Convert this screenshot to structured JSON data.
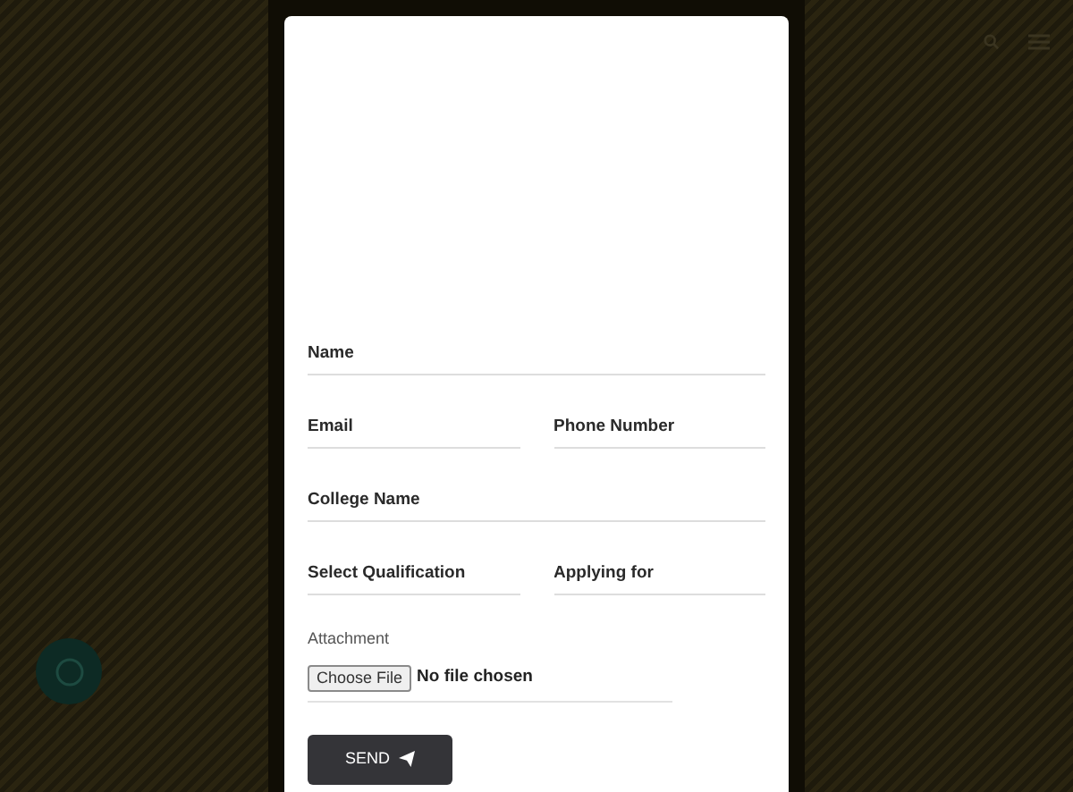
{
  "form": {
    "fields": [
      {
        "placeholder": "Name",
        "kind": "wide"
      },
      {
        "placeholder": "Email",
        "kind": "narrow"
      },
      {
        "placeholder": "Phone Number",
        "kind": "narrow"
      },
      {
        "placeholder": "College Name",
        "kind": "wide"
      },
      {
        "placeholder": "Select Qualification",
        "kind": "narrow"
      },
      {
        "placeholder": "Applying for",
        "kind": "narrow"
      }
    ],
    "attachment": {
      "label": "Attachment",
      "button": "Choose File",
      "status": "No file chosen"
    },
    "submit": "SEND"
  }
}
